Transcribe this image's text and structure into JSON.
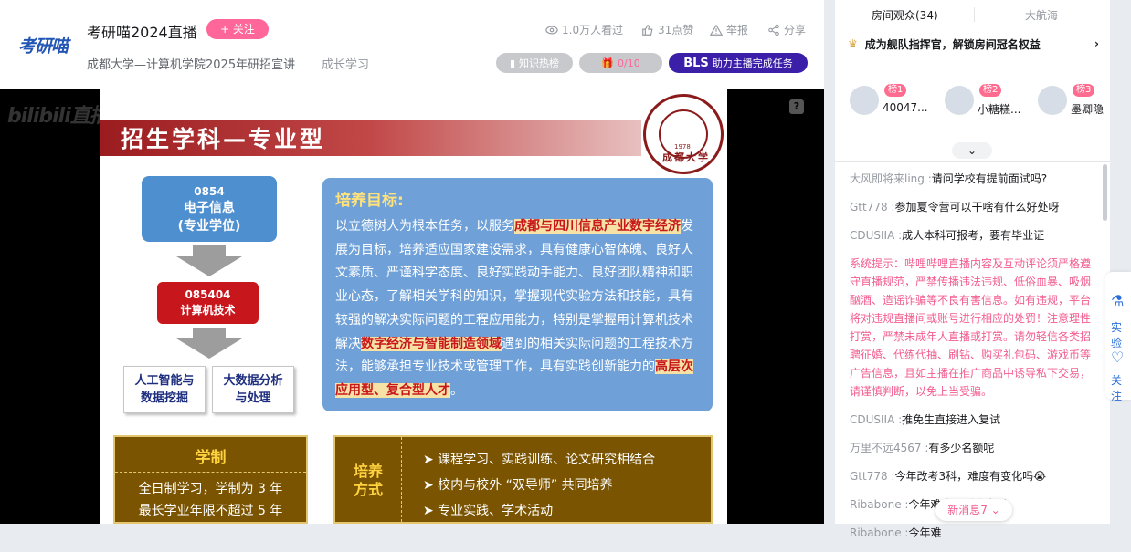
{
  "header": {
    "logo": "考研喵",
    "title": "考研喵2024直播",
    "follow_label": "+ 关注",
    "subtitle": "成都大学—计算机学院2025年研招宣讲",
    "category": "成长学习",
    "viewers": "1.0万人看过",
    "likes": "31点赞",
    "report": "举报",
    "share": "分享",
    "hot_badge": "知识热榜",
    "task_progress": "0/10",
    "bls_label": "BLS",
    "task_label": "助力主播完成任务"
  },
  "player": {
    "watermark": "bilibili直播",
    "help_label": "?"
  },
  "slide": {
    "banner_title": "招生学科—专业型",
    "seal_text": "成都大学",
    "seal_year": "1978",
    "degree_code": "0854",
    "degree_name": "电子信息",
    "degree_type": "(专业学位)",
    "field_code": "085404",
    "field_name": "计算机技术",
    "dir1_line1": "人工智能与",
    "dir1_line2": "数据挖掘",
    "dir2_line1": "大数据分析",
    "dir2_line2": "与处理",
    "goal_title": "培养目标:",
    "goal_p1": "以立德树人为根本任务，以服务",
    "goal_h1": "成都与四川信息产业数字经济",
    "goal_p2": "发展为目标，培养适应国家建设需求，具有健康心智体魄、良好人文素质、严谨科学态度、良好实践动手能力、良好团队精神和职业心态，了解相关学科的知识，掌握现代实验方法和技能，具有较强的解决实际问题的工程应用能力，特别是掌握用计算机技术解决",
    "goal_h2": "数字经济与智能制造领域",
    "goal_p3": "遇到的相关实际问题的工程技术方法，能够承担专业技术或管理工作，具有实践创新能力的",
    "goal_h3": "高层次应用型、复合型人才",
    "goal_end": "。",
    "xz_title": "学制",
    "xz_row1": "全日制学习，学制为 3 年",
    "xz_row2": "最长学业年限不超过 5 年",
    "py_label_1": "培养",
    "py_label_2": "方式",
    "py_rows": [
      "➤  课程学习、实践训练、论文研究相结合",
      "➤  校内与校外 “双导师” 共同培养",
      "➤  专业实践、学术活动"
    ]
  },
  "right_panel": {
    "tab_audience": "房间观众(34)",
    "tab_fleet": "大航海",
    "fleet_banner": "成为舰队指挥官，解锁房间冠名权益",
    "ranks": [
      {
        "badge": "榜1",
        "name": "40047..."
      },
      {
        "badge": "榜2",
        "name": "小糖糕..."
      },
      {
        "badge": "榜3",
        "name": "墨卿隐"
      }
    ],
    "chat": [
      {
        "user": "大风即将来ling :",
        "text": "请问学校有提前面试吗?"
      },
      {
        "user": "Gtt778 :",
        "text": "参加夏令营可以干啥有什么好处呀"
      },
      {
        "user": "CDUSIIA :",
        "text": "成人本科可报考，要有毕业证"
      },
      {
        "user": "",
        "text": "系统提示：哔哩哔哩直播内容及互动评论须严格遵守直播规范，严禁传播违法违规、低俗血暴、吸烟酗酒、造谣诈骗等不良有害信息。如有违规，平台将对违规直播间或账号进行相应的处罚！注意理性打赏，严禁未成年人直播或打赏。请勿轻信各类招聘征婚、代练代抽、刷钻、购买礼包码、游戏币等广告信息，且如主播在推广商品中诱导私下交易，请谨慎判断，以免上当受骗。",
        "system": true
      },
      {
        "user": "CDUSIIA :",
        "text": "推免生直接进入复试"
      },
      {
        "user": "万里不远4567 :",
        "text": "有多少名额呢"
      },
      {
        "user": "Gtt778 :",
        "text": "今年改考3科，难度有变化吗😭"
      },
      {
        "user": "Ribabone :",
        "text": "今年难度题型会变吗"
      },
      {
        "user": "Ribabone :",
        "text": "今年难"
      }
    ],
    "new_messages": "新消息7 ⌄",
    "float_1": "实验",
    "float_2": "关注"
  },
  "colors": {
    "accent_pink": "#ff6699",
    "bls_purple": "#3b1fa8",
    "system_pink": "#f25d8e"
  }
}
